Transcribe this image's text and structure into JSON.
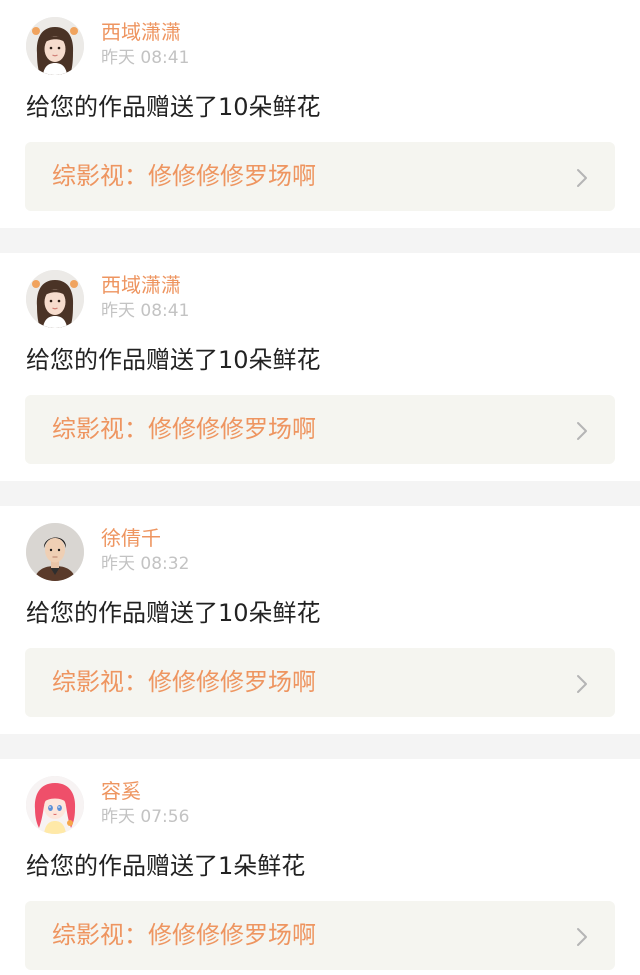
{
  "notifications": [
    {
      "username": "西域潇潇",
      "time": "昨天 08:41",
      "message": "给您的作品赠送了10朵鲜花",
      "work_title": "综影视：修修修修罗场啊",
      "avatar": "avatar-girl-brown-hair"
    },
    {
      "username": "西域潇潇",
      "time": "昨天 08:41",
      "message": "给您的作品赠送了10朵鲜花",
      "work_title": "综影视：修修修修罗场啊",
      "avatar": "avatar-girl-brown-hair"
    },
    {
      "username": "徐倩千",
      "time": "昨天 08:32",
      "message": "给您的作品赠送了10朵鲜花",
      "work_title": "综影视：修修修修罗场啊",
      "avatar": "avatar-man-dark-hair"
    },
    {
      "username": "容奚",
      "time": "昨天 07:56",
      "message": "给您的作品赠送了1朵鲜花",
      "work_title": "综影视：修修修修罗场啊",
      "avatar": "avatar-anime-pink-hair"
    }
  ],
  "colors": {
    "accent": "#ee9560",
    "time_text": "#c3c3c3",
    "body_text": "#222222",
    "link_bg": "#f5f5f0",
    "divider": "#f4f4f4",
    "chevron": "#b5b5b5"
  }
}
